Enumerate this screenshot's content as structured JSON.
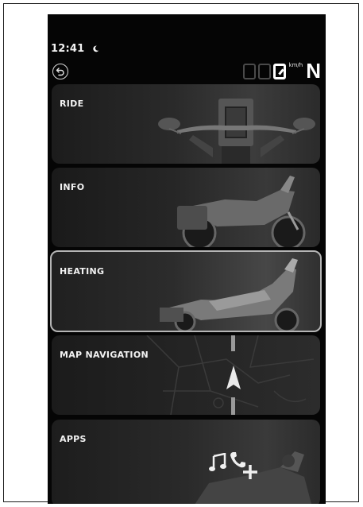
{
  "status_bar": {
    "time": "12:41",
    "night_mode_icon": "moon-icon"
  },
  "header": {
    "back_icon": "back-arrow-icon",
    "speed_value": "0",
    "speed_unit": "km/h",
    "gear": "N"
  },
  "menu": {
    "items": [
      {
        "label": "RIDE",
        "selected": false,
        "image": "handlebar-cockpit"
      },
      {
        "label": "INFO",
        "selected": false,
        "image": "motorcycle-side"
      },
      {
        "label": "HEATING",
        "selected": true,
        "image": "motorcycle-rear-three-quarter"
      },
      {
        "label": "MAP NAVIGATION",
        "selected": false,
        "image": "map-with-navigation-arrow"
      },
      {
        "label": "APPS",
        "selected": false,
        "image": "music-phone-plus-icons"
      }
    ]
  },
  "colors": {
    "background": "#050505",
    "tile": "#2a2a2a",
    "selected_border": "#b5b5b5",
    "text": "#f2f2f2"
  }
}
